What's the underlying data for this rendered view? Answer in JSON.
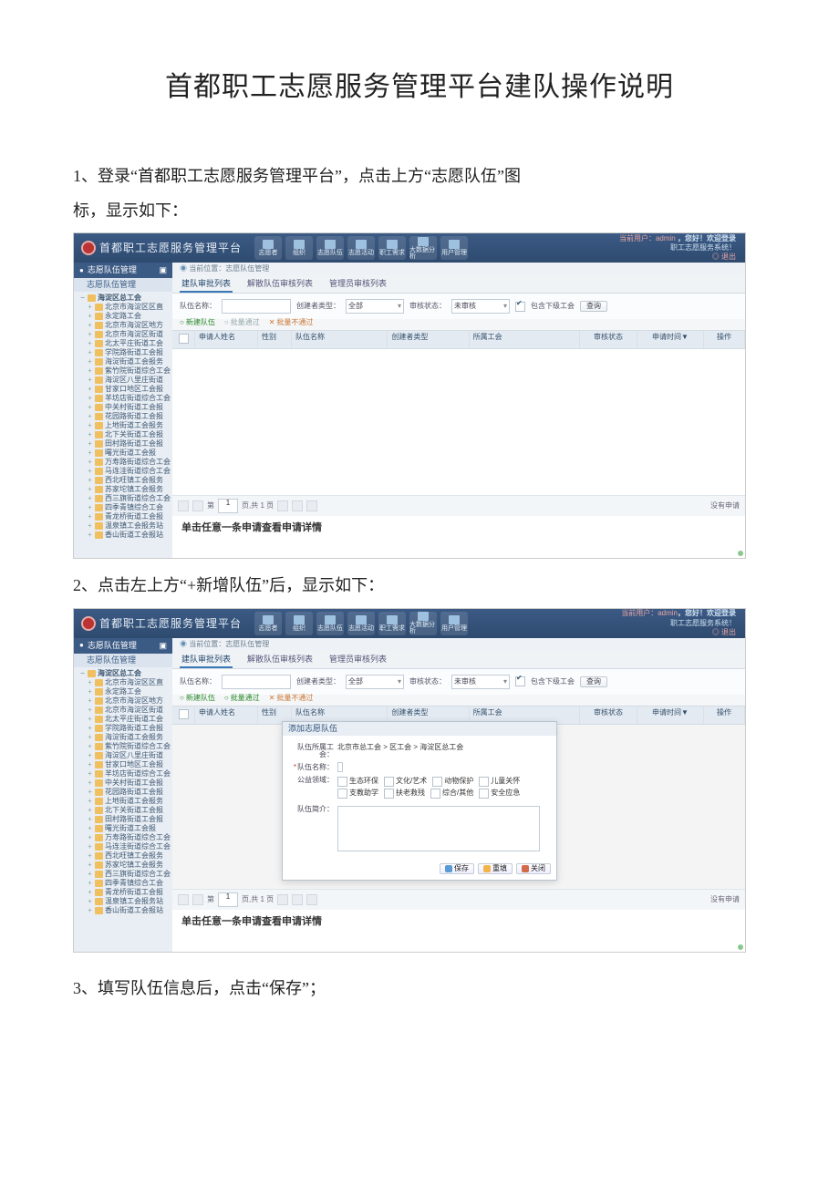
{
  "doc": {
    "title": "首都职工志愿服务管理平台建队操作说明",
    "step1a": "1、登录“首都职工志愿服务管理平台”，点击上方“志愿队伍”图",
    "step1b": "标，显示如下：",
    "step2": "2、点击左上方“+新增队伍”后，显示如下：",
    "step3": "3、填写队伍信息后，点击“保存”；"
  },
  "header": {
    "brand": "首都职工志愿服务管理平台",
    "nav": [
      "志愿者",
      "组织",
      "志愿队伍",
      "志愿活动",
      "职工需求",
      "大数据分析",
      "用户管理"
    ],
    "right_line1a": "当前用户：admin",
    "right_line1b": "，您好！欢迎登录",
    "right_line2": "职工志愿服务系统！",
    "logout": "◎ 退出"
  },
  "side": {
    "section_title": "志愿队伍管理",
    "sub_title": "志愿队伍管理",
    "tree_root": "海淀区总工会",
    "tree": [
      "北京市海淀区区直",
      "永定路工会",
      "北京市海淀区地方",
      "北京市海淀区街道",
      "北太平庄街道工会",
      "学院路街道工会报",
      "海淀街道工会报务",
      "紫竹院街道综合工会",
      "海淀区八里庄街道",
      "甘家口地区工会报",
      "羊坊店街道综合工会",
      "中关村街道工会报",
      "花园路街道工会报",
      "上地街道工会报务",
      "北下关街道工会报",
      "田村路街道工会报",
      "曙光街道工会报",
      "万寿路街道综合工会",
      "马连洼街道综合工会",
      "西北旺镇工会报务",
      "苏家坨镇工会报务",
      "西三旗街道综合工会",
      "四季青镇综合工会",
      "青龙桥街道工会报",
      "温泉镇工会报务站",
      "香山街道工会报站"
    ]
  },
  "content": {
    "crumbs": "当前位置：志愿队伍管理",
    "tabs": [
      "建队审批列表",
      "解散队伍审核列表",
      "管理员审核列表"
    ],
    "filter": {
      "name_label": "队伍名称：",
      "name_value": "",
      "creator_type_label": "创建者类型：",
      "creator_type_value": "全部",
      "audit_status_label": "审核状态：",
      "audit_status_value": "未审核",
      "include_sub_label": "包含下级工会",
      "query_btn": "查询"
    },
    "toolbar": {
      "add": "新建队伍",
      "audit": "批量通过",
      "del": "批量不通过"
    },
    "cols": {
      "name": "申请人姓名",
      "sex": "性别",
      "team": "队伍名称",
      "type": "创建者类型",
      "union": "所属工会",
      "status": "审核状态",
      "time": "申请时间",
      "time_sort": "▼",
      "op": "操作"
    },
    "pager": {
      "text_pre": "第",
      "page_val": "1",
      "text_mid": "页,共 1 页",
      "sep": "|",
      "records": "没有申请"
    },
    "detail_hint": "单击任意一条申请查看申请详情"
  },
  "dialog": {
    "title": "添加志愿队伍",
    "belong_label": "队伍所属工会：",
    "belong_value": "北京市总工会 > 区工会 > 海淀区总工会",
    "name_label": "队伍名称：",
    "name_value": "",
    "cat_label": "公益领域：",
    "cats": [
      "生态环保",
      "文化/艺术",
      "动物保护",
      "儿童关怀",
      "支教助学",
      "扶老救残",
      "综合/其他",
      "安全应急"
    ],
    "intro_label": "队伍简介：",
    "btn_save": "保存",
    "btn_reset": "重填",
    "btn_close": "关闭"
  }
}
